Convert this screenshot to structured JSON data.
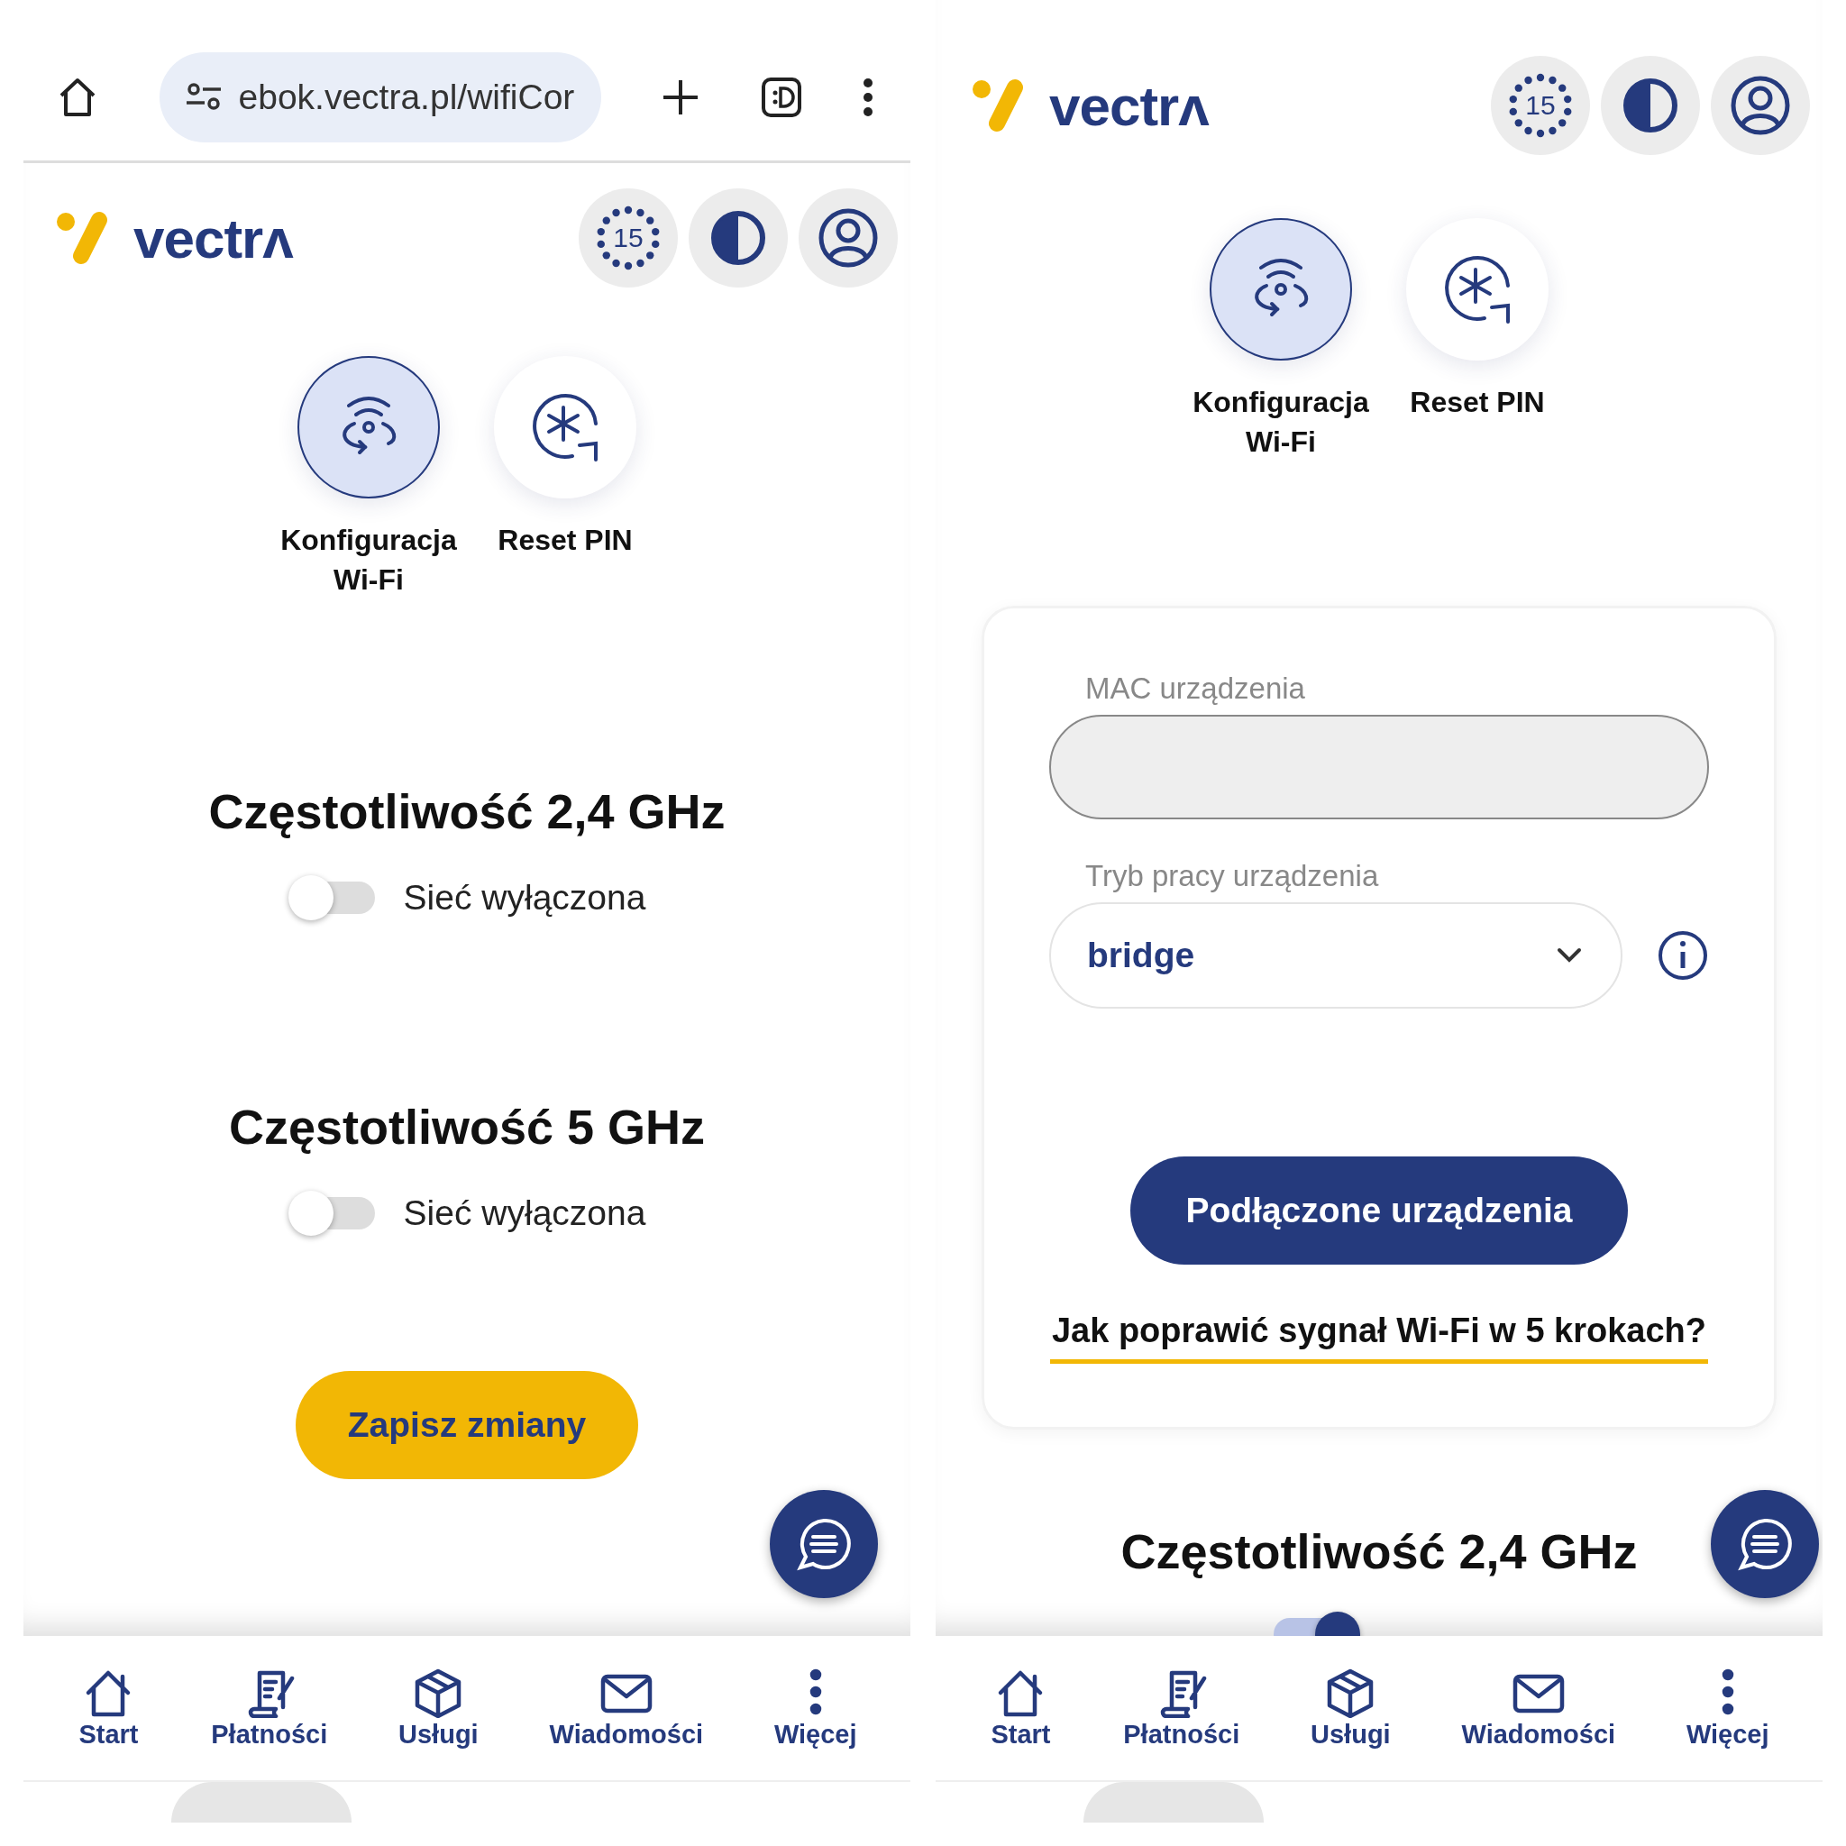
{
  "panels": [
    {
      "browser": {
        "url": "ebok.vectra.pl/wifiCor"
      },
      "logo": "vectrʌ",
      "timer": "15",
      "shortcuts": [
        {
          "label": "Konfiguracja Wi-Fi",
          "kind": "wifi",
          "selected": true
        },
        {
          "label": "Reset PIN",
          "kind": "pin",
          "selected": false
        }
      ],
      "sections": [
        {
          "title": "Częstotliwość 2,4 GHz",
          "toggle": {
            "label": "Sieć wyłączona",
            "on": false
          }
        },
        {
          "title": "Częstotliwość 5 GHz",
          "toggle": {
            "label": "Sieć wyłączona",
            "on": false
          }
        }
      ],
      "save_button": "Zapisz zmiany",
      "nav": [
        {
          "label": "Start",
          "kind": "home"
        },
        {
          "label": "Płatności",
          "kind": "bill"
        },
        {
          "label": "Usługi",
          "kind": "box"
        },
        {
          "label": "Wiadomości",
          "kind": "mail"
        },
        {
          "label": "Więcej",
          "kind": "more"
        }
      ]
    },
    {
      "logo": "vectrʌ",
      "timer": "15",
      "shortcuts": [
        {
          "label": "Konfiguracja Wi-Fi",
          "kind": "wifi",
          "selected": true
        },
        {
          "label": "Reset PIN",
          "kind": "pin",
          "selected": false
        }
      ],
      "form": {
        "mac": {
          "label": "MAC urządzenia"
        },
        "mode": {
          "label": "Tryb pracy urządzenia",
          "value": "bridge"
        },
        "devices_button": "Podłączone urządzenia",
        "help_link": "Jak poprawić sygnał Wi-Fi w 5 krokach?"
      },
      "sections": [
        {
          "title": "Częstotliwość 2,4 GHz",
          "toggle": {
            "on": true
          }
        }
      ],
      "nav": [
        {
          "label": "Start",
          "kind": "home"
        },
        {
          "label": "Płatności",
          "kind": "bill"
        },
        {
          "label": "Usługi",
          "kind": "box"
        },
        {
          "label": "Wiadomości",
          "kind": "mail"
        },
        {
          "label": "Więcej",
          "kind": "more"
        }
      ]
    }
  ]
}
